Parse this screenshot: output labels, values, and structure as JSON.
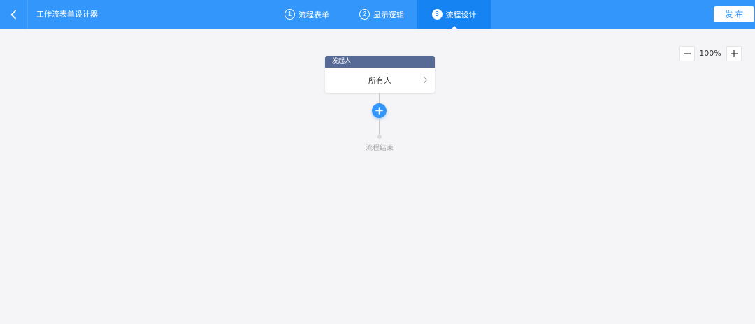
{
  "header": {
    "title": "工作流表单设计器",
    "steps": [
      {
        "num": "1",
        "label": "流程表单"
      },
      {
        "num": "2",
        "label": "显示逻辑"
      },
      {
        "num": "3",
        "label": "流程设计"
      }
    ],
    "active_step": 3,
    "publish_label": "发布",
    "colors": {
      "bar": "#3296fa",
      "active": "#1583f2"
    },
    "icons": {
      "back": "chevron-left-icon"
    }
  },
  "zoom": {
    "level": "100%",
    "icons": {
      "out": "minus-icon",
      "in": "plus-icon"
    }
  },
  "flow": {
    "start_node": {
      "header": "发起人",
      "value": "所有人",
      "header_color": "#576a95"
    },
    "end_label": "流程结束",
    "add_icon": "plus-icon"
  }
}
